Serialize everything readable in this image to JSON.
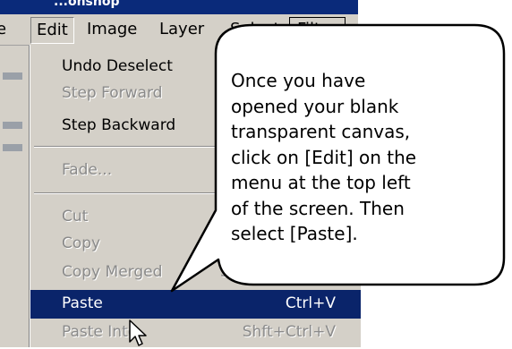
{
  "app": {
    "title_fragment": "...ohshop"
  },
  "menubar": {
    "cut_item": "e",
    "items": [
      "Edit",
      "Image",
      "Layer",
      "Select",
      "Filter"
    ]
  },
  "edit_menu": {
    "items": [
      {
        "label": "Undo Deselect",
        "shortcut": "",
        "state": "enabled"
      },
      {
        "label": "Step Forward",
        "shortcut": "",
        "state": "disabled"
      },
      {
        "label": "Step Backward",
        "shortcut": "",
        "state": "enabled"
      },
      {
        "label": "Fade...",
        "shortcut": "",
        "state": "disabled"
      },
      {
        "label": "Cut",
        "shortcut": "",
        "state": "disabled"
      },
      {
        "label": "Copy",
        "shortcut": "",
        "state": "disabled"
      },
      {
        "label": "Copy Merged",
        "shortcut": "Sh",
        "state": "disabled"
      },
      {
        "label": "Paste",
        "shortcut": "Ctrl+V",
        "state": "highlighted"
      },
      {
        "label": "Paste Into",
        "shortcut": "Shft+Ctrl+V",
        "state": "disabled"
      }
    ]
  },
  "callout": {
    "lines": [
      "Once you have",
      "opened your blank",
      "transparent canvas,",
      "click on [Edit] on the",
      "menu at the top left",
      "of the screen. Then",
      "select [Paste]."
    ]
  },
  "colors": {
    "menu_bg": "#d4d0c8",
    "highlight": "#0a246a",
    "disabled_text": "#8a8a8a",
    "title_bar": "#0a2a7a"
  },
  "icons": [
    "arrow-cursor-icon"
  ]
}
